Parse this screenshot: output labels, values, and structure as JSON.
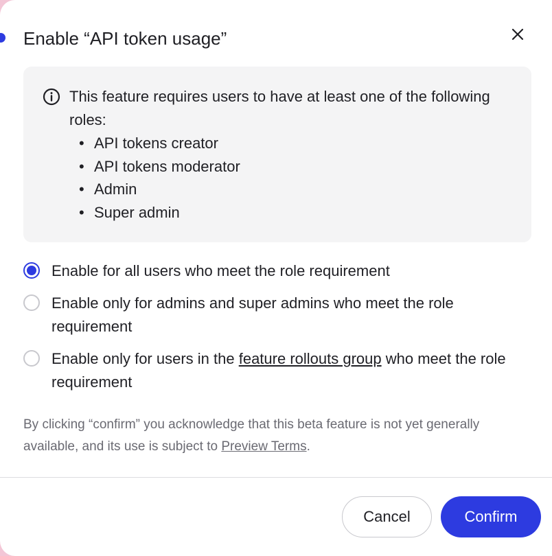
{
  "dialog": {
    "title": "Enable “API token usage”",
    "close_icon": "close-icon"
  },
  "info": {
    "icon": "info-icon",
    "text": "This feature requires users to have at least one of the following roles:",
    "roles": [
      "API tokens creator",
      "API tokens moderator",
      "Admin",
      "Super admin"
    ],
    "bullet": "•"
  },
  "options": [
    {
      "label": "Enable for all users who meet the role requirement",
      "checked": true
    },
    {
      "label": "Enable only for admins and super admins who meet the role requirement",
      "checked": false
    },
    {
      "label_before": "Enable only for users in the ",
      "link": "feature rollouts group",
      "label_after": " who meet the role requirement",
      "checked": false
    }
  ],
  "disclaimer": {
    "text": "By clicking “confirm” you acknowledge that this beta feature is not yet generally available, and its use is subject to ",
    "link": "Preview Terms",
    "end": "."
  },
  "buttons": {
    "cancel": "Cancel",
    "confirm": "Confirm"
  },
  "colors": {
    "accent": "#2d3be0",
    "info_bg": "#f4f4f5",
    "muted_text": "#6a6a72"
  }
}
